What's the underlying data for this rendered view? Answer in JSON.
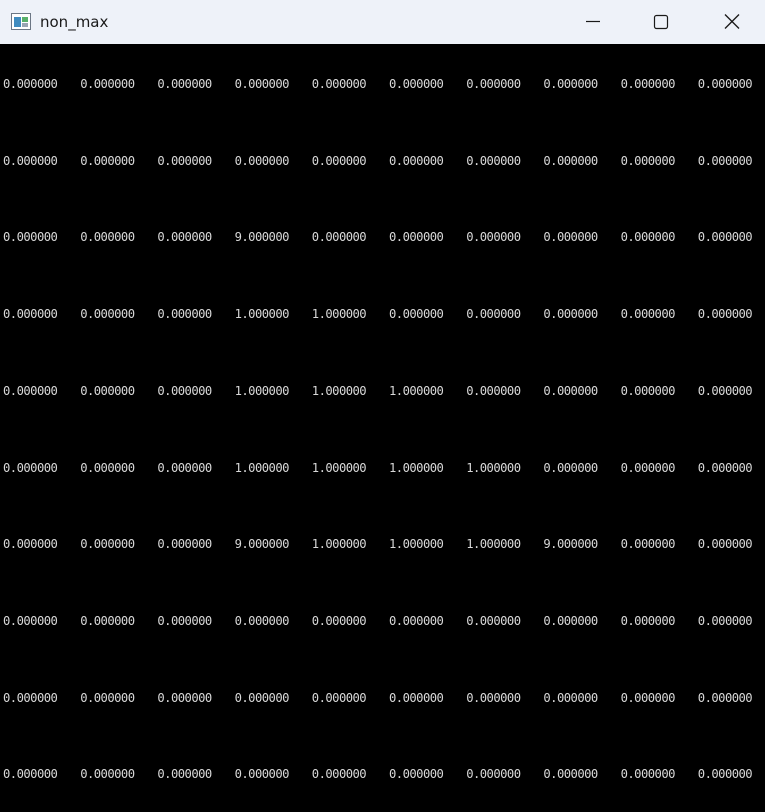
{
  "window": {
    "title": "non_max",
    "icon": "app-window-icon",
    "controls": {
      "minimize": "minimize-icon",
      "maximize": "maximize-icon",
      "close": "close-icon"
    }
  },
  "colors": {
    "titlebar": "#eef2f9",
    "canvas": "#000000",
    "text": "#d8d8d8"
  },
  "matrix": {
    "rows": [
      [
        "0.000000",
        "0.000000",
        "0.000000",
        "0.000000",
        "0.000000",
        "0.000000",
        "0.000000",
        "0.000000",
        "0.000000",
        "0.000000"
      ],
      [
        "0.000000",
        "0.000000",
        "0.000000",
        "0.000000",
        "0.000000",
        "0.000000",
        "0.000000",
        "0.000000",
        "0.000000",
        "0.000000"
      ],
      [
        "0.000000",
        "0.000000",
        "0.000000",
        "9.000000",
        "0.000000",
        "0.000000",
        "0.000000",
        "0.000000",
        "0.000000",
        "0.000000"
      ],
      [
        "0.000000",
        "0.000000",
        "0.000000",
        "1.000000",
        "1.000000",
        "0.000000",
        "0.000000",
        "0.000000",
        "0.000000",
        "0.000000"
      ],
      [
        "0.000000",
        "0.000000",
        "0.000000",
        "1.000000",
        "1.000000",
        "1.000000",
        "0.000000",
        "0.000000",
        "0.000000",
        "0.000000"
      ],
      [
        "0.000000",
        "0.000000",
        "0.000000",
        "1.000000",
        "1.000000",
        "1.000000",
        "1.000000",
        "0.000000",
        "0.000000",
        "0.000000"
      ],
      [
        "0.000000",
        "0.000000",
        "0.000000",
        "9.000000",
        "1.000000",
        "1.000000",
        "1.000000",
        "9.000000",
        "0.000000",
        "0.000000"
      ],
      [
        "0.000000",
        "0.000000",
        "0.000000",
        "0.000000",
        "0.000000",
        "0.000000",
        "0.000000",
        "0.000000",
        "0.000000",
        "0.000000"
      ],
      [
        "0.000000",
        "0.000000",
        "0.000000",
        "0.000000",
        "0.000000",
        "0.000000",
        "0.000000",
        "0.000000",
        "0.000000",
        "0.000000"
      ],
      [
        "0.000000",
        "0.000000",
        "0.000000",
        "0.000000",
        "0.000000",
        "0.000000",
        "0.000000",
        "0.000000",
        "0.000000",
        "0.000000"
      ]
    ]
  }
}
